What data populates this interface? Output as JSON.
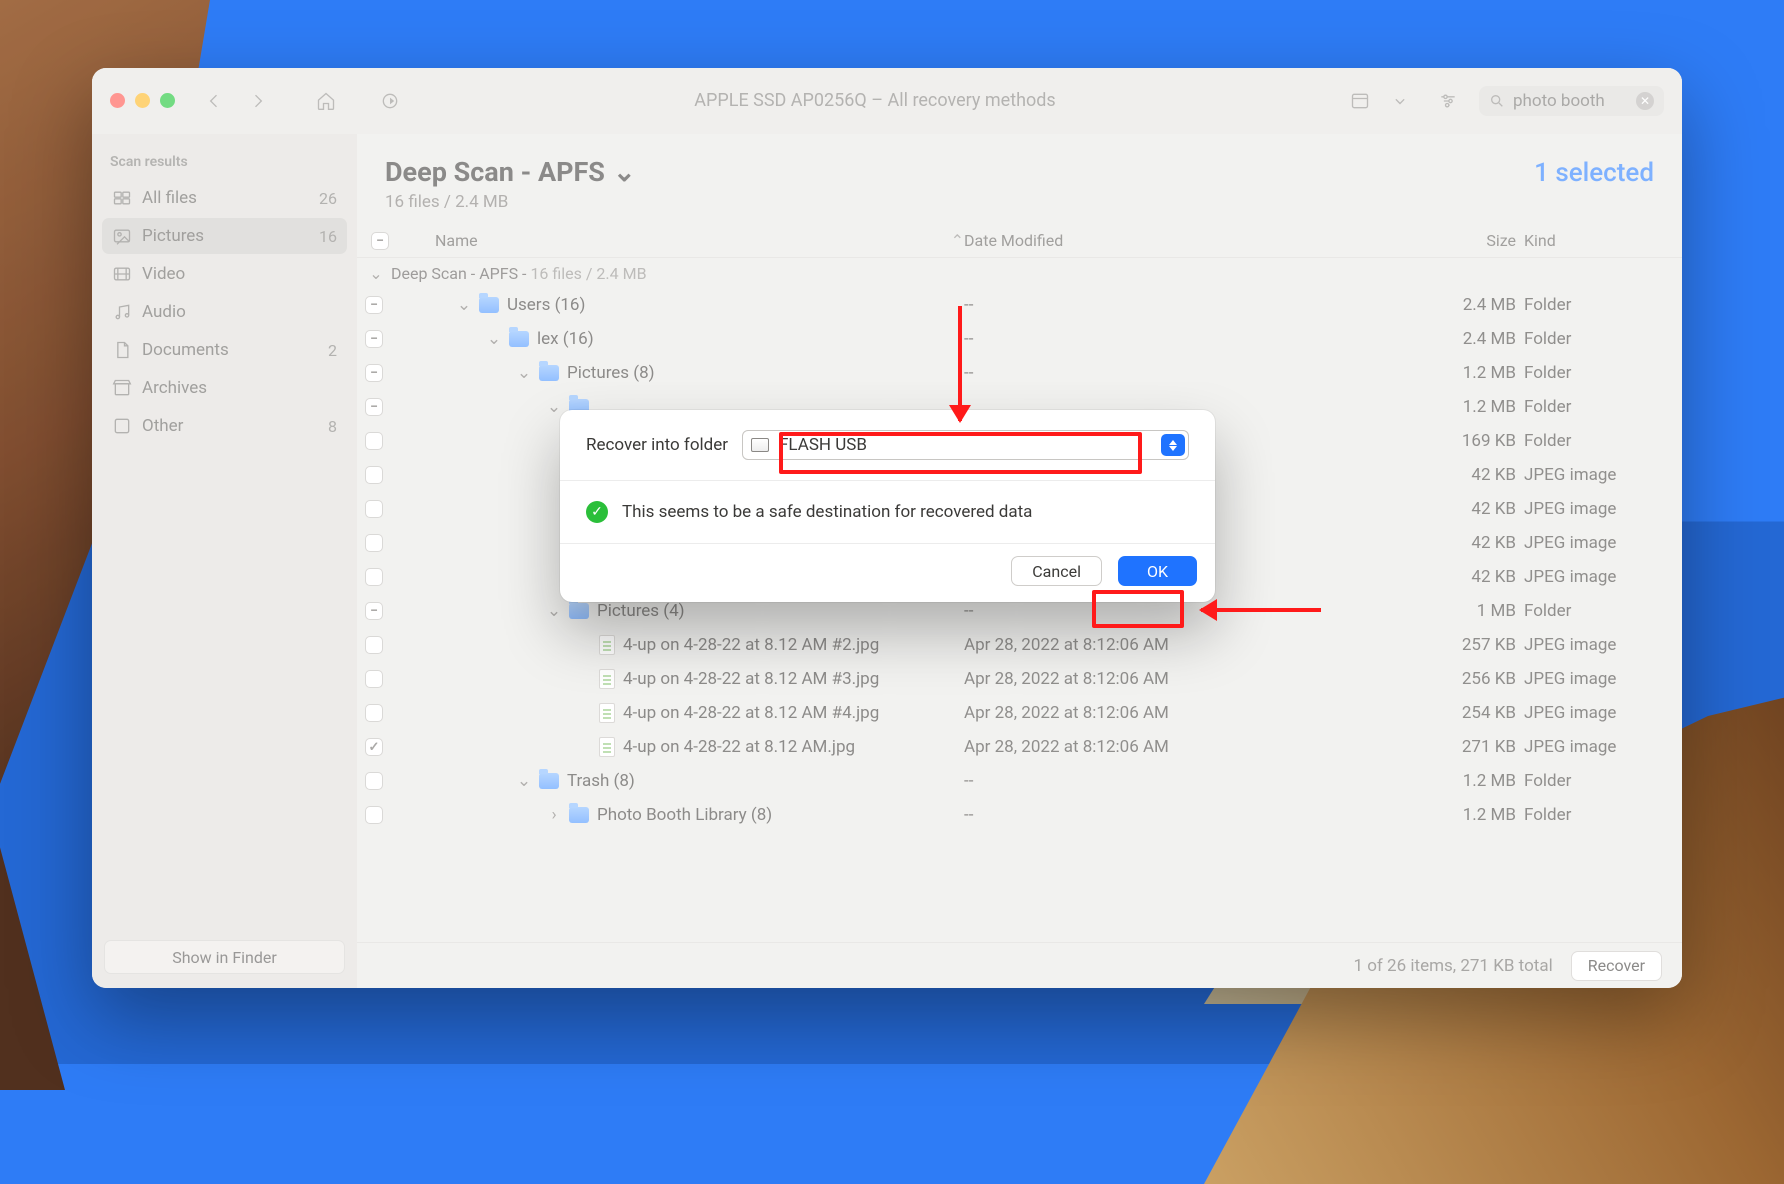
{
  "window": {
    "title": "APPLE SSD AP0256Q – All recovery methods",
    "search_value": "photo booth"
  },
  "sidebar": {
    "heading": "Scan results",
    "items": [
      {
        "label": "All files",
        "count": "26"
      },
      {
        "label": "Pictures",
        "count": "16"
      },
      {
        "label": "Video",
        "count": ""
      },
      {
        "label": "Audio",
        "count": ""
      },
      {
        "label": "Documents",
        "count": "2"
      },
      {
        "label": "Archives",
        "count": ""
      },
      {
        "label": "Other",
        "count": "8"
      }
    ],
    "footer_button": "Show in Finder"
  },
  "main": {
    "title": "Deep Scan - APFS",
    "subtitle": "16 files / 2.4 MB",
    "selected_label": "1 selected",
    "columns": {
      "name": "Name",
      "date": "Date Modified",
      "size": "Size",
      "kind": "Kind"
    },
    "group_label_prefix": "Deep Scan - APFS - ",
    "group_label_suffix": "16 files / 2.4 MB"
  },
  "rows": [
    {
      "indent": 1,
      "cb": "minus",
      "disc": "down",
      "icon": "folder",
      "name": "Users (16)",
      "date": "--",
      "size": "2.4 MB",
      "kind": "Folder"
    },
    {
      "indent": 2,
      "cb": "minus",
      "disc": "down",
      "icon": "folder",
      "name": "lex (16)",
      "date": "--",
      "size": "2.4 MB",
      "kind": "Folder"
    },
    {
      "indent": 3,
      "cb": "minus",
      "disc": "down",
      "icon": "folder",
      "name": "Pictures (8)",
      "date": "--",
      "size": "1.2 MB",
      "kind": "Folder"
    },
    {
      "indent": 4,
      "cb": "minus",
      "disc": "down",
      "icon": "folder",
      "name": "",
      "date": "",
      "size": "1.2 MB",
      "kind": "Folder"
    },
    {
      "indent": 5,
      "cb": "empty",
      "disc": "down",
      "icon": "folder",
      "name": "",
      "date": "",
      "size": "169 KB",
      "kind": "Folder"
    },
    {
      "indent": 6,
      "cb": "empty",
      "disc": "none",
      "icon": "file",
      "name": "",
      "date": "",
      "size": "42 KB",
      "kind": "JPEG image"
    },
    {
      "indent": 6,
      "cb": "empty",
      "disc": "none",
      "icon": "file",
      "name": "",
      "date": "",
      "size": "42 KB",
      "kind": "JPEG image"
    },
    {
      "indent": 6,
      "cb": "empty",
      "disc": "none",
      "icon": "file",
      "name": "",
      "date": "",
      "size": "42 KB",
      "kind": "JPEG image"
    },
    {
      "indent": 6,
      "cb": "empty",
      "disc": "none",
      "icon": "file",
      "name": "",
      "date": "",
      "size": "42 KB",
      "kind": "JPEG image"
    },
    {
      "indent": 4,
      "cb": "minus",
      "disc": "down",
      "icon": "folder",
      "name": "Pictures (4)",
      "date": "--",
      "size": "1 MB",
      "kind": "Folder"
    },
    {
      "indent": 5,
      "cb": "empty",
      "disc": "none",
      "icon": "file",
      "name": "4-up on 4-28-22 at 8.12 AM #2.jpg",
      "date": "Apr 28, 2022 at 8:12:06 AM",
      "size": "257 KB",
      "kind": "JPEG image"
    },
    {
      "indent": 5,
      "cb": "empty",
      "disc": "none",
      "icon": "file",
      "name": "4-up on 4-28-22 at 8.12 AM #3.jpg",
      "date": "Apr 28, 2022 at 8:12:06 AM",
      "size": "256 KB",
      "kind": "JPEG image"
    },
    {
      "indent": 5,
      "cb": "empty",
      "disc": "none",
      "icon": "file",
      "name": "4-up on 4-28-22 at 8.12 AM #4.jpg",
      "date": "Apr 28, 2022 at 8:12:06 AM",
      "size": "254 KB",
      "kind": "JPEG image"
    },
    {
      "indent": 5,
      "cb": "check",
      "disc": "none",
      "icon": "file",
      "name": "4-up on 4-28-22 at 8.12 AM.jpg",
      "date": "Apr 28, 2022 at 8:12:06 AM",
      "size": "271 KB",
      "kind": "JPEG image"
    },
    {
      "indent": 3,
      "cb": "empty",
      "disc": "down",
      "icon": "folder",
      "name": "Trash (8)",
      "date": "--",
      "size": "1.2 MB",
      "kind": "Folder"
    },
    {
      "indent": 4,
      "cb": "empty",
      "disc": "right",
      "icon": "folder",
      "name": "Photo Booth Library (8)",
      "date": "--",
      "size": "1.2 MB",
      "kind": "Folder"
    }
  ],
  "status": {
    "summary": "1 of 26 items, 271 KB total",
    "recover": "Recover"
  },
  "dialog": {
    "label": "Recover into folder",
    "destination": "FLASH USB",
    "safe_msg": "This seems to be a safe destination for recovered data",
    "cancel": "Cancel",
    "ok": "OK"
  }
}
